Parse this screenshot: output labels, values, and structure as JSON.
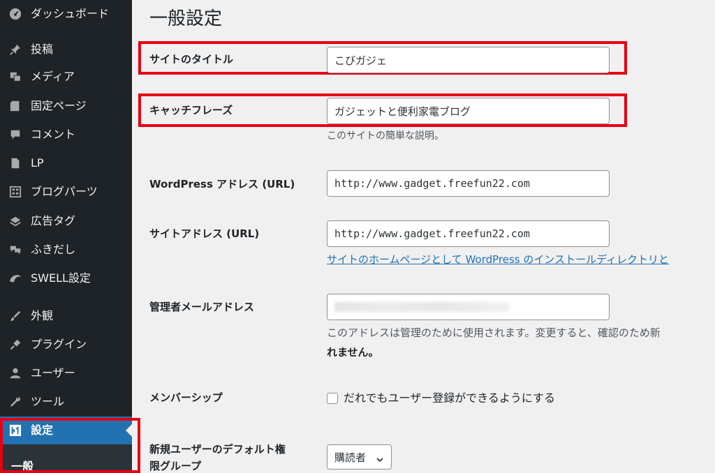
{
  "sidebar": {
    "items": [
      {
        "label": "ダッシュボード",
        "icon": "dashboard-icon"
      },
      {
        "label": "投稿",
        "icon": "pin-icon"
      },
      {
        "label": "メディア",
        "icon": "media-icon"
      },
      {
        "label": "固定ページ",
        "icon": "page-icon"
      },
      {
        "label": "コメント",
        "icon": "comment-icon"
      },
      {
        "label": "LP",
        "icon": "document-icon"
      },
      {
        "label": "ブログパーツ",
        "icon": "grid-icon"
      },
      {
        "label": "広告タグ",
        "icon": "stack-icon"
      },
      {
        "label": "ふきだし",
        "icon": "speech-bubble-icon"
      },
      {
        "label": "SWELL設定",
        "icon": "swell-icon"
      },
      {
        "label": "外観",
        "icon": "brush-icon"
      },
      {
        "label": "プラグイン",
        "icon": "plug-icon"
      },
      {
        "label": "ユーザー",
        "icon": "user-icon"
      },
      {
        "label": "ツール",
        "icon": "wrench-icon"
      },
      {
        "label": "設定",
        "icon": "settings-icon"
      }
    ],
    "submenu_current": "一般"
  },
  "page": {
    "title": "一般設定"
  },
  "fields": {
    "site_title": {
      "label": "サイトのタイトル",
      "value": "こびガジェ"
    },
    "tagline": {
      "label": "キャッチフレーズ",
      "value": "ガジェットと便利家電ブログ",
      "description": "このサイトの簡単な説明。"
    },
    "wp_address": {
      "label": "WordPress アドレス (URL)",
      "value": "http://www.gadget.freefun22.com"
    },
    "site_address": {
      "label": "サイトアドレス (URL)",
      "value": "http://www.gadget.freefun22.com",
      "link": "サイトのホームページとして WordPress のインストールディレクトリと"
    },
    "admin_email": {
      "label": "管理者メールアドレス",
      "description_line1": "このアドレスは管理のために使用されます。変更すると、確認のため新",
      "description_line2": "れません。"
    },
    "membership": {
      "label": "メンバーシップ",
      "checkbox_label": "だれでもユーザー登録ができるようにする",
      "checked": false
    },
    "default_role": {
      "label_line1": "新規ユーザーのデフォルト権",
      "label_line2": "限グループ",
      "value": "購読者"
    }
  },
  "colors": {
    "sidebar_bg": "#1d2327",
    "accent": "#2271b1",
    "highlight_red": "#e60012",
    "page_bg": "#f0f0f1"
  }
}
